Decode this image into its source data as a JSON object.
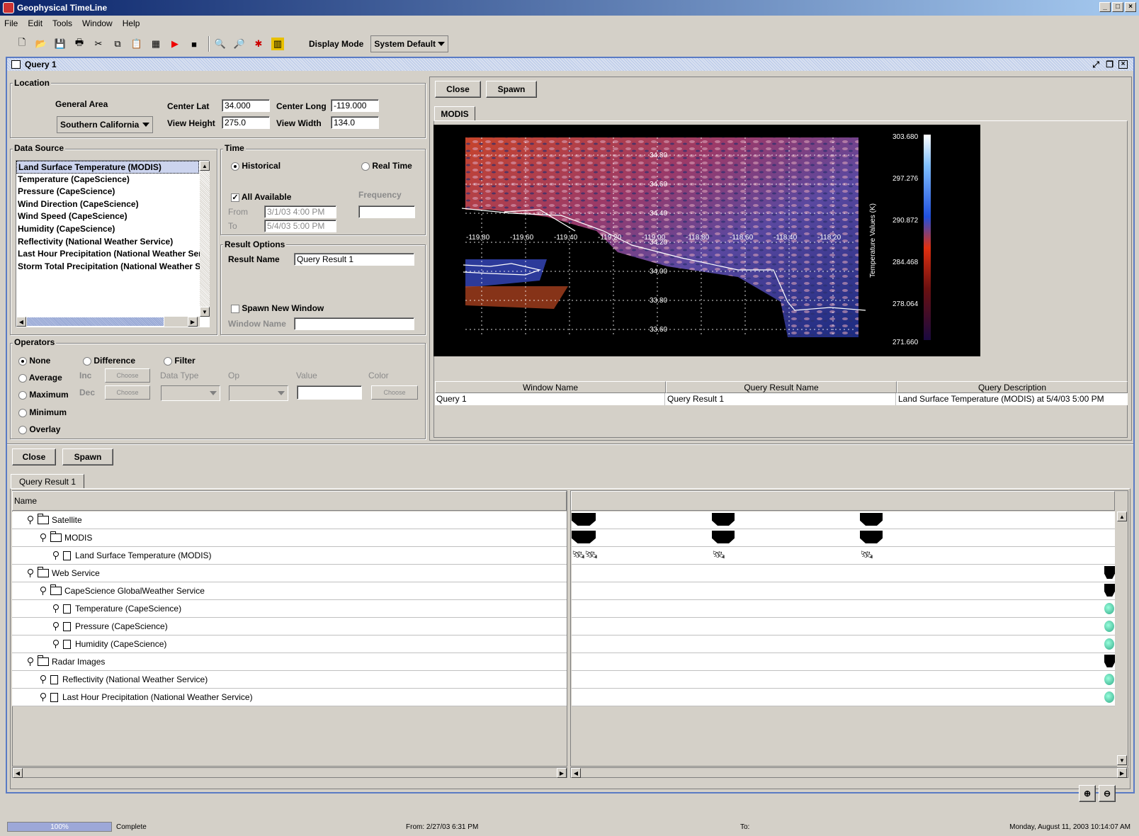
{
  "window": {
    "title": "Geophysical TimeLine"
  },
  "menu": [
    "File",
    "Edit",
    "Tools",
    "Window",
    "Help"
  ],
  "toolbar": {
    "display_mode_label": "Display Mode",
    "display_mode_value": "System Default"
  },
  "query_window": {
    "title": "Query 1"
  },
  "location": {
    "label": "Location",
    "general_area_label": "General Area",
    "general_area_value": "Southern California",
    "center_lat_label": "Center Lat",
    "center_lat": "34.000",
    "center_long_label": "Center Long",
    "center_long": "-119.000",
    "view_height_label": "View Height",
    "view_height": "275.0",
    "view_width_label": "View Width",
    "view_width": "134.0"
  },
  "data_source": {
    "label": "Data Source",
    "items": [
      "Land Surface Temperature (MODIS)",
      "Temperature (CapeScience)",
      "Pressure (CapeScience)",
      "Wind Direction (CapeScience)",
      "Wind Speed (CapeScience)",
      "Humidity (CapeScience)",
      "Reflectivity (National Weather Service)",
      "Last Hour Precipitation (National Weather Ser",
      "Storm Total Precipitation (National Weather S"
    ]
  },
  "time": {
    "label": "Time",
    "historical": "Historical",
    "real_time": "Real Time",
    "all_available": "All Available",
    "frequency": "Frequency",
    "from_label": "From",
    "from_value": "3/1/03 4:00 PM",
    "to_label": "To",
    "to_value": "5/4/03 5:00 PM"
  },
  "result_options": {
    "label": "Result Options",
    "result_name_label": "Result Name",
    "result_name": "Query Result 1",
    "spawn_new_window": "Spawn New Window",
    "window_name_label": "Window Name"
  },
  "operators": {
    "label": "Operators",
    "none": "None",
    "difference": "Difference",
    "filter": "Filter",
    "average": "Average",
    "maximum": "Maximum",
    "minimum": "Minimum",
    "overlay": "Overlay",
    "inc": "Inc",
    "dec": "Dec",
    "choose": "Choose",
    "data_type": "Data Type",
    "op": "Op",
    "value": "Value",
    "color": "Color"
  },
  "buttons": {
    "close": "Close",
    "spawn": "Spawn"
  },
  "viewer": {
    "tab": "MODIS",
    "lat_labels": [
      "34.80",
      "34.60",
      "34.40",
      "34.20",
      "34.00",
      "33.80",
      "33.60"
    ],
    "lon_labels": [
      "-119.80",
      "-119.60",
      "-119.40",
      "-119.20",
      "-119.00",
      "-118.80",
      "-118.60",
      "-118.40",
      "-118.20"
    ],
    "colorbar_values": [
      "303.680",
      "297.276",
      "290.872",
      "284.468",
      "278.064",
      "271.660"
    ],
    "colorbar_title": "Temperature Values (K)"
  },
  "query_table": {
    "headers": [
      "Window Name",
      "Query Result Name",
      "Query Description"
    ],
    "rows": [
      [
        "Query 1",
        "Query Result 1",
        "Land Surface Temperature (MODIS) at 5/4/03 5:00 PM"
      ]
    ]
  },
  "result_tab": "Query Result 1",
  "tree": {
    "header": "Name",
    "rows": [
      {
        "label": "Satellite",
        "level": 1,
        "type": "folder"
      },
      {
        "label": "MODIS",
        "level": 2,
        "type": "folder"
      },
      {
        "label": "Land Surface Temperature (MODIS)",
        "level": 3,
        "type": "doc"
      },
      {
        "label": "Web Service",
        "level": 1,
        "type": "folder"
      },
      {
        "label": "CapeScience GlobalWeather Service",
        "level": 2,
        "type": "folder"
      },
      {
        "label": "Temperature (CapeScience)",
        "level": 3,
        "type": "doc"
      },
      {
        "label": "Pressure (CapeScience)",
        "level": 3,
        "type": "doc"
      },
      {
        "label": "Humidity (CapeScience)",
        "level": 3,
        "type": "doc"
      },
      {
        "label": "Radar Images",
        "level": 1,
        "type": "folder"
      },
      {
        "label": "Reflectivity (National Weather Service)",
        "level": 2,
        "type": "doc"
      },
      {
        "label": "Last Hour Precipitation (National Weather Service)",
        "level": 2,
        "type": "doc"
      }
    ]
  },
  "status": {
    "progress": "100%",
    "state": "Complete",
    "from": "From:  2/27/03 6:31 PM",
    "to": "To:",
    "datetime": "Monday, August 11, 2003 10:14:07 AM"
  }
}
